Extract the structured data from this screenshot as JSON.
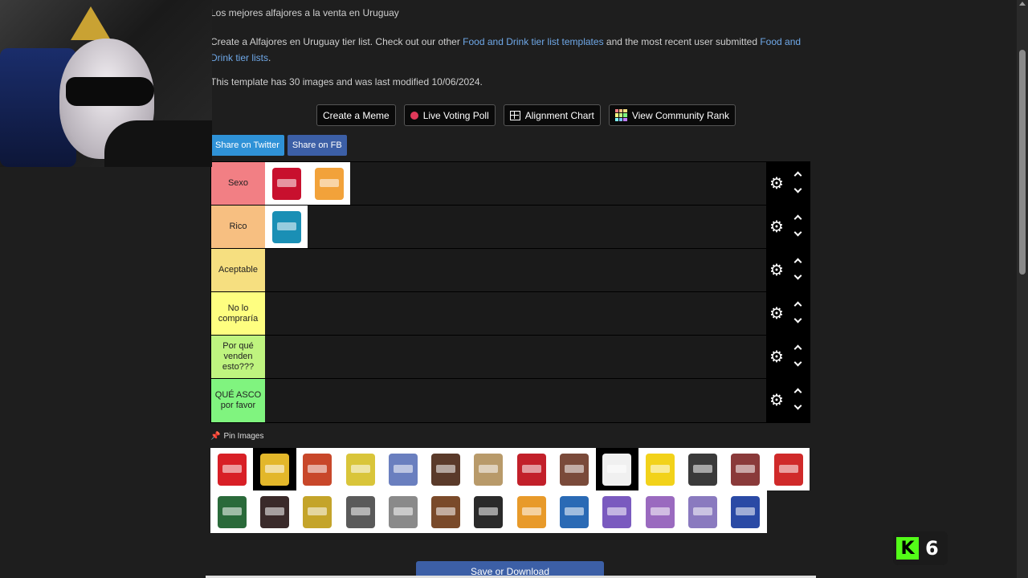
{
  "page": {
    "subtitle": "Los mejores alfajores a la venta en Uruguay",
    "desc_prefix": "Create a Alfajores en Uruguay tier list. Check out our other ",
    "desc_link1": "Food and Drink tier list templates",
    "desc_mid": " and the most recent user submitted ",
    "desc_link2": "Food and Drink tier lists",
    "desc_suffix": ".",
    "meta": "This template has 30 images and was last modified 10/06/2024."
  },
  "actions": {
    "meme": "Create a Meme",
    "poll": "Live Voting Poll",
    "alignment": "Alignment Chart",
    "community": "View Community Rank"
  },
  "share": {
    "twitter": "Share on Twitter",
    "facebook": "Share on FB"
  },
  "tiers": [
    {
      "label": "Sexo",
      "color": "#f27f84",
      "items": [
        "#c8102e",
        "#f2a23a"
      ]
    },
    {
      "label": "Rico",
      "color": "#f7bf81",
      "items": [
        "#1a8fb5"
      ]
    },
    {
      "label": "Aceptable",
      "color": "#f6df80",
      "items": []
    },
    {
      "label": "No lo compraría",
      "color": "#fefe80",
      "items": []
    },
    {
      "label": "Por qué venden esto???",
      "color": "#bff47f",
      "items": []
    },
    {
      "label": "QUÉ ASCO por favor",
      "color": "#80f47f",
      "items": []
    }
  ],
  "pin_label": "Pin Images",
  "pool": [
    "#d81f26",
    "#e3b72a",
    "#c8472a",
    "#d9c53a",
    "#6a7fbf",
    "#5a3a2a",
    "#b89a6a",
    "#c2202a",
    "#7a4a3a",
    "#f0f0f0",
    "#f2d21a",
    "#3a3a3a",
    "#8a3a3a",
    "#d02a2a",
    "#2a6a3a",
    "#3a2a2a",
    "#c4a42a",
    "#5a5a5a",
    "#8a8a8a",
    "#7a4a2a",
    "#2a2a2a",
    "#e89a2a",
    "#2a6ab5",
    "#7a5abf",
    "#9a6abf",
    "#8a7abf",
    "#2a4aa5"
  ],
  "save_label": "Save or Download",
  "kick": {
    "count": "6"
  }
}
